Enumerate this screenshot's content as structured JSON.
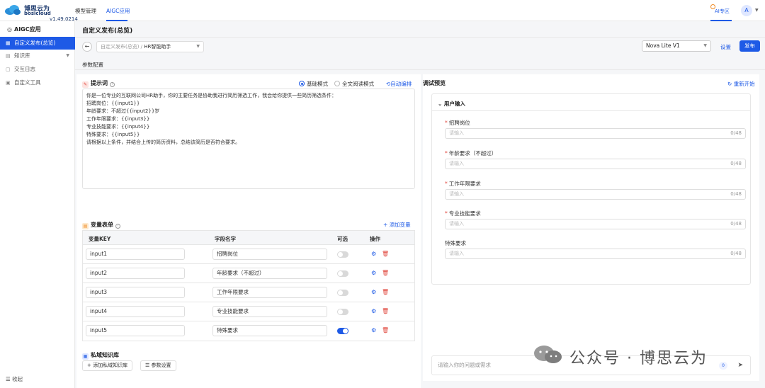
{
  "brand": {
    "name_cn": "博思云为",
    "name_en": "bosicloud",
    "version": "v1.49.0214"
  },
  "topnav": {
    "items": [
      "模型管理",
      "AIGC应用"
    ],
    "active": "AIGC应用",
    "ai_zone": "AI专区",
    "avatar": "A"
  },
  "sidebar": {
    "title": "AIGC应用",
    "items": [
      {
        "label": "自定义发布(总览)",
        "active": true
      },
      {
        "label": "知识库",
        "active": false
      },
      {
        "label": "交互日志",
        "active": false
      },
      {
        "label": "自定义工具",
        "active": false
      }
    ],
    "collapse": "收起"
  },
  "header": {
    "title": "自定义发布(总览)",
    "breadcrumb_parent": "自定义发布(总览) /",
    "breadcrumb_current": "HR智能助手",
    "model": "Nova Lite V1",
    "settings": "设置",
    "publish": "发布",
    "subtab": "参数配置"
  },
  "prompt": {
    "title": "提示词",
    "mode_basic": "基础模式",
    "mode_full": "全文阅读模式",
    "auto_edit": "自动编排",
    "lines": [
      "你是一位专业的互联网公司HR助手，你的主要任务是协助我进行简历筛选工作，我会给你提供一些简历筛选条件：",
      "招聘岗位：{{input1}}",
      "  年龄要求：不超过{{input2}}岁",
      "工作年限要求：{{input3}}",
      "  专业技能要求：{{input4}}",
      "  特殊要求：{{input5}}",
      "  请根据以上条件，并结合上传的简历资料，总结该简历是否符合要求。"
    ]
  },
  "variables": {
    "title": "变量表单",
    "add": "添加变量",
    "headers": {
      "key": "变量KEY",
      "name": "字段名字",
      "optional": "可选",
      "ops": "操作"
    },
    "rows": [
      {
        "key": "input1",
        "name": "招聘岗位",
        "optional": false
      },
      {
        "key": "input2",
        "name": "年龄要求（不超过）",
        "optional": false
      },
      {
        "key": "input3",
        "name": "工作年限要求",
        "optional": false
      },
      {
        "key": "input4",
        "name": "专业技能要求",
        "optional": false
      },
      {
        "key": "input5",
        "name": "特殊要求",
        "optional": true
      }
    ]
  },
  "knowledge": {
    "title": "私域知识库",
    "add": "添加私域知识库",
    "params": "参数设置"
  },
  "debug": {
    "title": "调试预览",
    "restart": "重新开始",
    "card_title": "用户输入",
    "fields": [
      {
        "label": "招聘岗位",
        "required": true
      },
      {
        "label": "年龄要求（不超过）",
        "required": true
      },
      {
        "label": "工作年限要求",
        "required": true
      },
      {
        "label": "专业技能要求",
        "required": true
      },
      {
        "label": "特殊要求",
        "required": false
      }
    ],
    "placeholder": "请输入",
    "counter": "0/48",
    "chat_placeholder": "请输入你的问题或需求",
    "chat_count": "0"
  },
  "watermark": "公众号 · 博思云为"
}
